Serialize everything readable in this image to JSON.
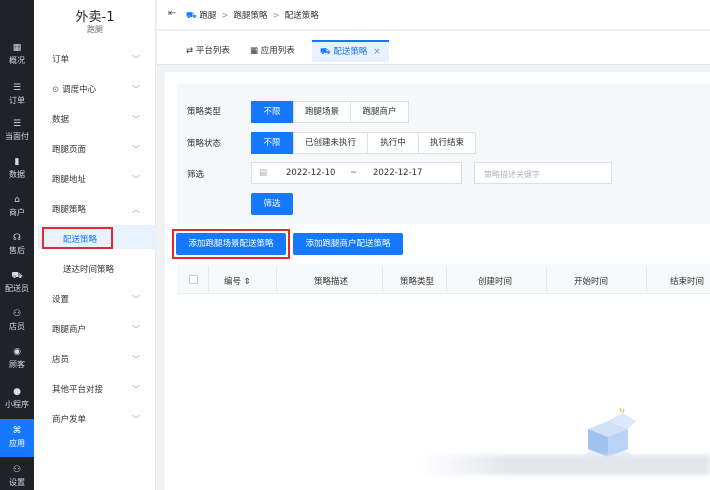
{
  "rail": [
    {
      "icon": "▦",
      "label": "概况"
    },
    {
      "icon": "☰",
      "label": "订单"
    },
    {
      "icon": "☰",
      "label": "当面付"
    },
    {
      "icon": "▮",
      "label": "数据"
    },
    {
      "icon": "⌂",
      "label": "商户"
    },
    {
      "icon": "☊",
      "label": "售后"
    },
    {
      "icon": "⛟",
      "label": "配送员"
    },
    {
      "icon": "⚇",
      "label": "店员"
    },
    {
      "icon": "◉",
      "label": "顾客"
    },
    {
      "icon": "●",
      "label": "小程序"
    },
    {
      "icon": "⌘",
      "label": "应用"
    },
    {
      "icon": "⚇",
      "label": "设置"
    }
  ],
  "app": {
    "title": "外卖-1",
    "subtitle": "跑腿"
  },
  "menu": [
    {
      "label": "订单"
    },
    {
      "label": "调度中心"
    },
    {
      "label": "数据"
    },
    {
      "label": "跑腿页面"
    },
    {
      "label": "跑腿地址"
    },
    {
      "label": "跑腿策略"
    },
    {
      "label": "设置"
    },
    {
      "label": "跑腿商户"
    },
    {
      "label": "店员"
    },
    {
      "label": "其他平台对接"
    },
    {
      "label": "商户发单"
    }
  ],
  "submenu": {
    "active": "配送策略",
    "other": "送达时间策略"
  },
  "breadcrumb": {
    "root": "跑腿",
    "parent": "跑腿策略",
    "current": "配送策略"
  },
  "tabs": [
    {
      "label": "平台列表"
    },
    {
      "label": "应用列表"
    },
    {
      "label": "配送策略",
      "close": "×"
    }
  ],
  "filters": {
    "type_label": "策略类型",
    "type_options": [
      "不限",
      "跑腿场景",
      "跑腿商户"
    ],
    "status_label": "策略状态",
    "status_options": [
      "不限",
      "已创建未执行",
      "执行中",
      "执行结束"
    ],
    "filter_label": "筛选",
    "date_start": "2022-12-10",
    "date_sep": "~",
    "date_end": "2022-12-17",
    "keyword_placeholder": "策略描述关键字",
    "filter_button": "筛选"
  },
  "actions": {
    "add_scene": "添加跑腿场景配送策略",
    "add_merchant": "添加跑腿商户配送策略"
  },
  "table": {
    "columns": [
      "编号 ⇕",
      "策略描述",
      "策略类型",
      "创建时间",
      "开始时间",
      "结束时间"
    ]
  },
  "colors": {
    "primary": "#1677ff",
    "highlight": "#e5282b",
    "rail": "#1f2229"
  }
}
